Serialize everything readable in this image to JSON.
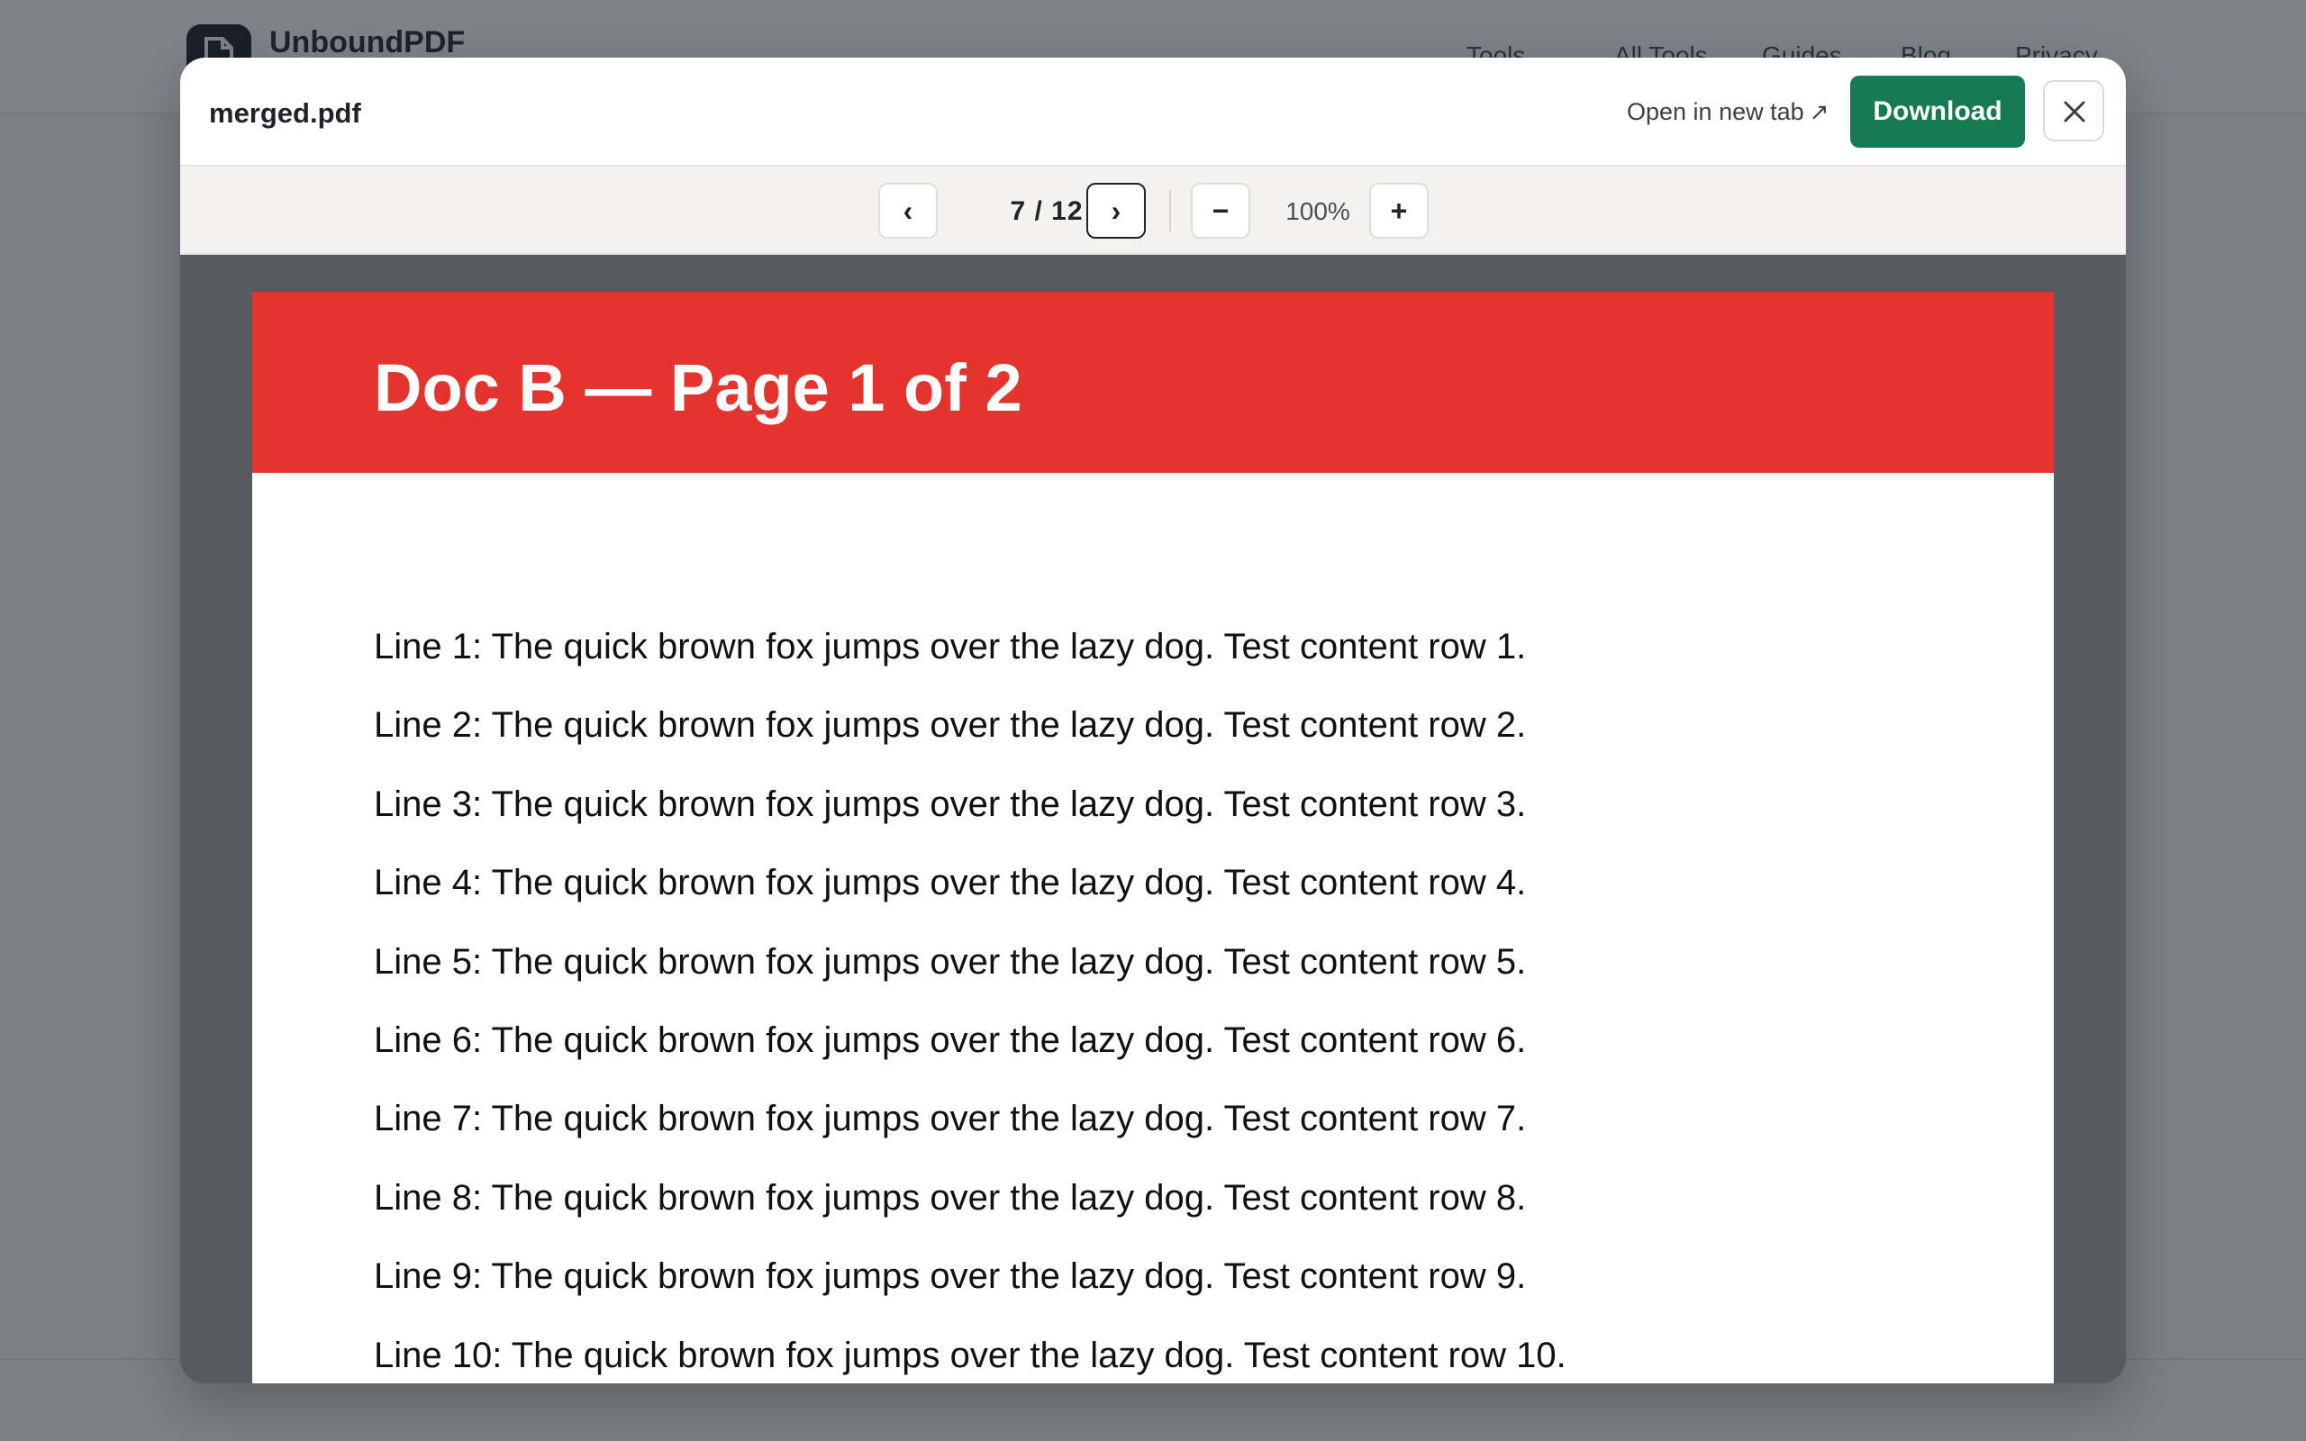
{
  "background": {
    "brand": "UnboundPDF",
    "nav": [
      "Tools",
      "All Tools",
      "Guides",
      "Blog",
      "Privacy"
    ]
  },
  "modal": {
    "file_name": "merged.pdf",
    "open_new_tab": "Open in new tab",
    "download_label": "Download"
  },
  "toolbar": {
    "prev_label": "‹",
    "next_label": "›",
    "page_indicator": "7 / 12",
    "zoom_out_label": "−",
    "zoom_in_label": "+",
    "zoom_level": "100%"
  },
  "page": {
    "title": "Doc B — Page 1 of 2",
    "lines": [
      "Line 1: The quick brown fox jumps over the lazy dog. Test content row 1.",
      "Line 2: The quick brown fox jumps over the lazy dog. Test content row 2.",
      "Line 3: The quick brown fox jumps over the lazy dog. Test content row 3.",
      "Line 4: The quick brown fox jumps over the lazy dog. Test content row 4.",
      "Line 5: The quick brown fox jumps over the lazy dog. Test content row 5.",
      "Line 6: The quick brown fox jumps over the lazy dog. Test content row 6.",
      "Line 7: The quick brown fox jumps over the lazy dog. Test content row 7.",
      "Line 8: The quick brown fox jumps over the lazy dog. Test content row 8.",
      "Line 9: The quick brown fox jumps over the lazy dog. Test content row 9.",
      "Line 10: The quick brown fox jumps over the lazy dog. Test content row 10."
    ]
  },
  "colors": {
    "banner": "#e5332e",
    "download": "#157a52",
    "overlay": "#7b8087"
  },
  "icons": {
    "logo": "document-icon",
    "close": "close-icon",
    "external": "external-link-icon",
    "dropdown": "chevron-down-icon"
  }
}
